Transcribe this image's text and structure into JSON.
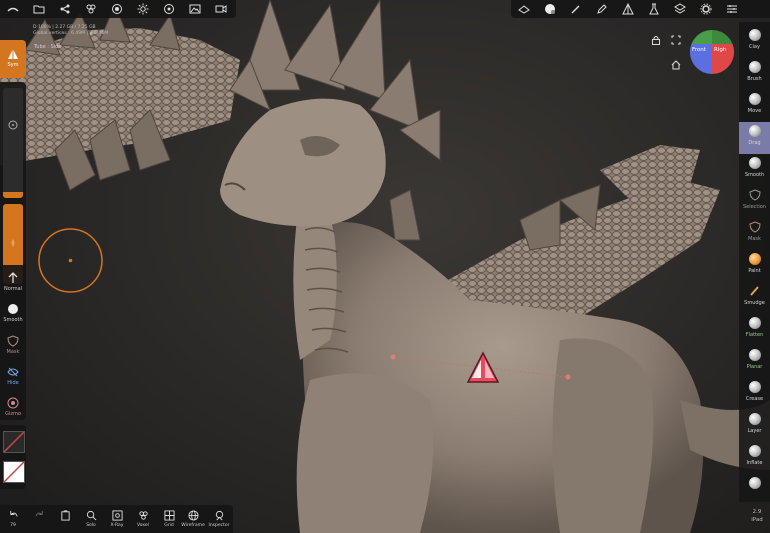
{
  "stats": {
    "line1": "D:100% | 2.27 GB / 7.25 GB",
    "line2": "Global vertices : 6.49M   |  ▲ 6.48M"
  },
  "topology_label": "Tube : Side",
  "left_tools": {
    "sym": "Sym",
    "normal": "Normal",
    "smooth": "Smooth",
    "mask": "Mask",
    "hide": "Hide",
    "gizmo": "Gizmo"
  },
  "right_tools": [
    "Clay",
    "Brush",
    "Move",
    "Drag",
    "Smooth",
    "Selection",
    "Mask",
    "Paint",
    "Smudge",
    "Flatten",
    "Planar",
    "Crease",
    "Layer",
    "Inflate"
  ],
  "right_active": "Drag",
  "bottom_tools": {
    "undo_count": "79",
    "solo": "Solo",
    "xray": "X-Ray",
    "voxel": "Voxel",
    "grid": "Grid",
    "wireframe": "Wireframe",
    "inspector": "Inspector"
  },
  "gizmo": {
    "front": "Front",
    "right": "Righ"
  },
  "device": {
    "version": "2.9",
    "platform": "iPad"
  },
  "colors": {
    "accent": "#d4761f",
    "active_tool": "#7b7ba8",
    "sym_marker": "#e84a5f"
  }
}
